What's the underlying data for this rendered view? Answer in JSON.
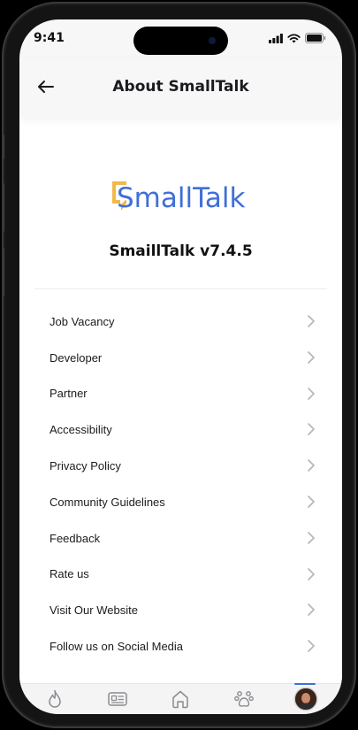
{
  "status_bar": {
    "time": "9:41"
  },
  "header": {
    "title": "About SmallTalk"
  },
  "brand": {
    "logo_text": "SmallTalk",
    "version_text": "SmaillTalk v7.4.5",
    "colors": {
      "accent_blue": "#3f6fd8",
      "accent_gold": "#f2b84b"
    }
  },
  "menu": {
    "items": [
      {
        "label": "Job Vacancy"
      },
      {
        "label": "Developer"
      },
      {
        "label": "Partner"
      },
      {
        "label": "Accessibility"
      },
      {
        "label": "Privacy Policy"
      },
      {
        "label": "Community Guidelines"
      },
      {
        "label": "Feedback"
      },
      {
        "label": "Rate us"
      },
      {
        "label": "Visit Our Website"
      },
      {
        "label": "Follow us on Social Media"
      }
    ]
  },
  "tab_bar": {
    "tabs": [
      {
        "icon": "flame-icon"
      },
      {
        "icon": "news-icon"
      },
      {
        "icon": "home-icon"
      },
      {
        "icon": "paw-icon"
      },
      {
        "icon": "profile-avatar",
        "active": true
      }
    ]
  }
}
